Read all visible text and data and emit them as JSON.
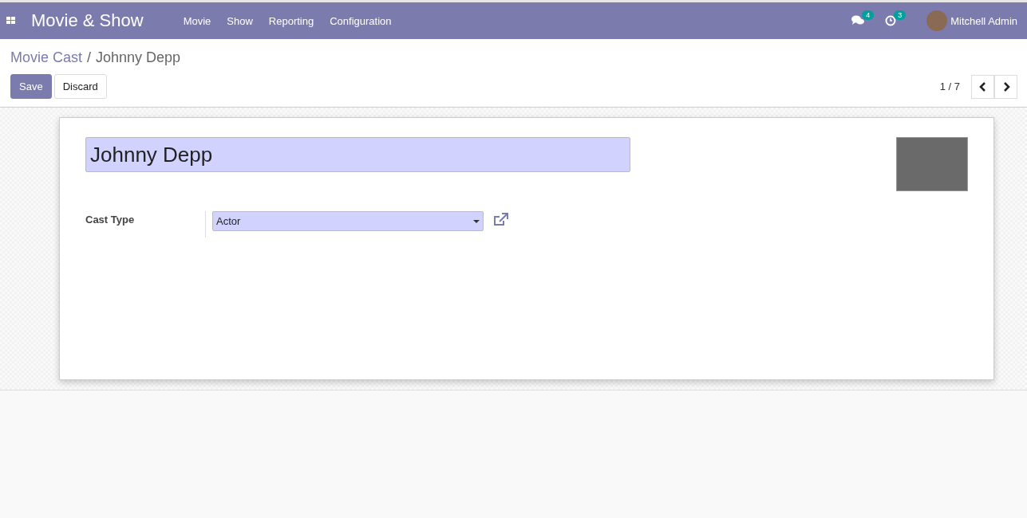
{
  "navbar": {
    "app_title": "Movie & Show",
    "menu": [
      "Movie",
      "Show",
      "Reporting",
      "Configuration"
    ],
    "messages_count": "4",
    "activities_count": "3",
    "user": "Mitchell Admin"
  },
  "breadcrumb_separator": "/",
  "breadcrumb": [
    {
      "label": "Movie Cast",
      "link": true
    },
    {
      "label": "Johnny Depp",
      "link": false
    }
  ],
  "buttons": [
    {
      "label": "Save",
      "kind": "primary"
    },
    {
      "label": "Discard",
      "kind": "secondary"
    }
  ],
  "pager": {
    "value": "1 / 7"
  },
  "form": {
    "name": "Johnny Depp",
    "fields": [
      {
        "label": "Cast Type",
        "value": "Actor"
      }
    ]
  }
}
